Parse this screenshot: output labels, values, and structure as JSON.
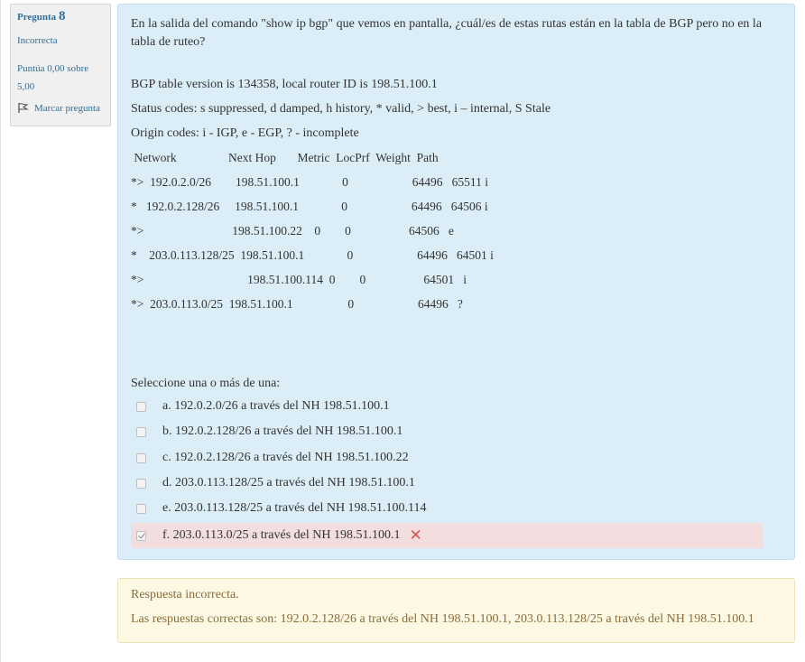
{
  "info": {
    "question_label": "Pregunta",
    "question_number": "8",
    "state": "Incorrecta",
    "grade": "Puntúa 0,00 sobre 5,00",
    "flag_label": "Marcar pregunta"
  },
  "question": {
    "text": "En la salida del comando \"show ip bgp\" que vemos en pantalla, ¿cuál/es de estas rutas están en la tabla de BGP pero no en la tabla de ruteo?",
    "output_lines": [
      "BGP table version is 134358, local router ID is 198.51.100.1",
      "Status codes: s suppressed, d damped, h history, * valid, > best, i – internal, S Stale",
      "Origin codes: i - IGP, e - EGP, ? - incomplete",
      " Network                 Next Hop       Metric  LocPrf  Weight  Path",
      "*>  192.0.2.0/26        198.51.100.1              0                     64496   65511 i",
      "*   192.0.2.128/26     198.51.100.1              0                     64496   64506 i",
      "*>                             198.51.100.22    0        0                   64506   e",
      "*    203.0.113.128/25  198.51.100.1              0                     64496   64501 i",
      "*>                                  198.51.100.114  0        0                   64501   i",
      "*>  203.0.113.0/25  198.51.100.1                  0                     64496   ?"
    ],
    "prompt": "Seleccione una o más de una:",
    "options": [
      {
        "letter": "a.",
        "text": "192.0.2.0/26 a través del NH 198.51.100.1",
        "checked": false
      },
      {
        "letter": "b.",
        "text": "192.0.2.128/26 a través del NH 198.51.100.1",
        "checked": false
      },
      {
        "letter": "c.",
        "text": "192.0.2.128/26 a través del NH 198.51.100.22",
        "checked": false
      },
      {
        "letter": "d.",
        "text": "203.0.113.128/25 a través del NH 198.51.100.1",
        "checked": false
      },
      {
        "letter": "e.",
        "text": "203.0.113.128/25 a través del NH 198.51.100.114",
        "checked": false
      },
      {
        "letter": "f.",
        "text": "203.0.113.0/25 a través del NH 198.51.100.1",
        "checked": true,
        "incorrect": true
      }
    ]
  },
  "outcome": {
    "feedback": "Respuesta incorrecta.",
    "right_answer": "Las respuestas correctas son: 192.0.2.128/26 a través del NH 198.51.100.1, 203.0.113.128/25 a través del NH 198.51.100.1"
  },
  "colors": {
    "question_bg": "#dbeef7",
    "incorrect_bg": "#f2dede",
    "outcome_bg": "#fcf8e3",
    "link": "#2f6f99",
    "error": "#d9534f"
  }
}
